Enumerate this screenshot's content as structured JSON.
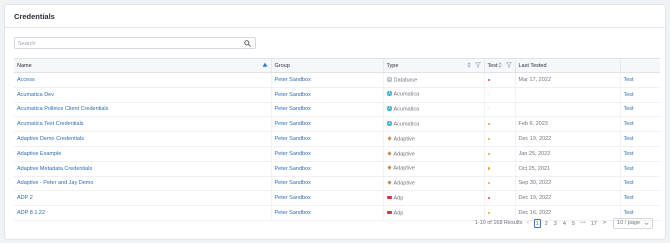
{
  "page": {
    "title": "Credentials"
  },
  "search": {
    "placeholder": "Search"
  },
  "table": {
    "headers": {
      "name": "Name",
      "group": "Group",
      "type": "Type",
      "test": "Test",
      "last_tested": "Last Tested"
    },
    "rows": [
      {
        "name": "Access",
        "group": "Peter Sandbox",
        "type": "Database",
        "type_icon": "database-icon",
        "test_status": "failed",
        "last_tested": "Mar 17, 2022",
        "action": "Test"
      },
      {
        "name": "Acumatica Dev",
        "group": "Peter Sandbox",
        "type": "Acumatica",
        "type_icon": "acumatica-icon",
        "test_status": "none",
        "last_tested": "",
        "action": "Test"
      },
      {
        "name": "Acumatica Polleice Client Credentials",
        "group": "Peter Sandbox",
        "type": "Acumatica",
        "type_icon": "acumatica-icon",
        "test_status": "none",
        "last_tested": "",
        "action": "Test"
      },
      {
        "name": "Acumatica Test Credentials",
        "group": "Peter Sandbox",
        "type": "Acumatica",
        "type_icon": "acumatica-icon",
        "test_status": "passed",
        "last_tested": "Feb 6, 2023",
        "action": "Test"
      },
      {
        "name": "Adaptive Demo Credentials",
        "group": "Peter Sandbox",
        "type": "Adaptive",
        "type_icon": "adaptive-icon",
        "test_status": "passed",
        "last_tested": "Dec 19, 2022",
        "action": "Test"
      },
      {
        "name": "Adaptive Example",
        "group": "Peter Sandbox",
        "type": "Adaptive",
        "type_icon": "adaptive-icon",
        "test_status": "passed",
        "last_tested": "Jan 25, 2022",
        "action": "Test"
      },
      {
        "name": "Adaptive Metadata Credentials",
        "group": "Peter Sandbox",
        "type": "Adaptive",
        "type_icon": "adaptive-icon",
        "test_status": "passed",
        "last_tested": "Oct 25, 2021",
        "action": "Test"
      },
      {
        "name": "Adaptive - Peter and Jay Demo",
        "group": "Peter Sandbox",
        "type": "Adaptive",
        "type_icon": "adaptive-icon",
        "test_status": "passed",
        "last_tested": "Sep 30, 2022",
        "action": "Test"
      },
      {
        "name": "ADP 2",
        "group": "Peter Sandbox",
        "type": "Adp",
        "type_icon": "adp-icon",
        "test_status": "failed",
        "last_tested": "Dec 19, 2022",
        "action": "Test"
      },
      {
        "name": "ADP 8.1.22",
        "group": "Peter Sandbox",
        "type": "Adp",
        "type_icon": "adp-icon",
        "test_status": "passed",
        "last_tested": "Dec 16, 2022",
        "action": "Test"
      }
    ]
  },
  "pagination": {
    "summary": "1-10 of 168 Results",
    "prev": "<",
    "pages": [
      "1",
      "2",
      "3",
      "4",
      "5"
    ],
    "current": "1",
    "ellipsis": "•••",
    "last_page": "17",
    "next": ">",
    "page_size": "10 / page"
  },
  "colors": {
    "link": "#2f6db5",
    "status_failed": "#e5484d",
    "status_passed": "#e8a33c",
    "database_icon": "#7d8590",
    "acumatica_icon": "#1aa3c9",
    "adaptive_icon": "#c98a4a",
    "adp_icon": "#d9363e"
  }
}
